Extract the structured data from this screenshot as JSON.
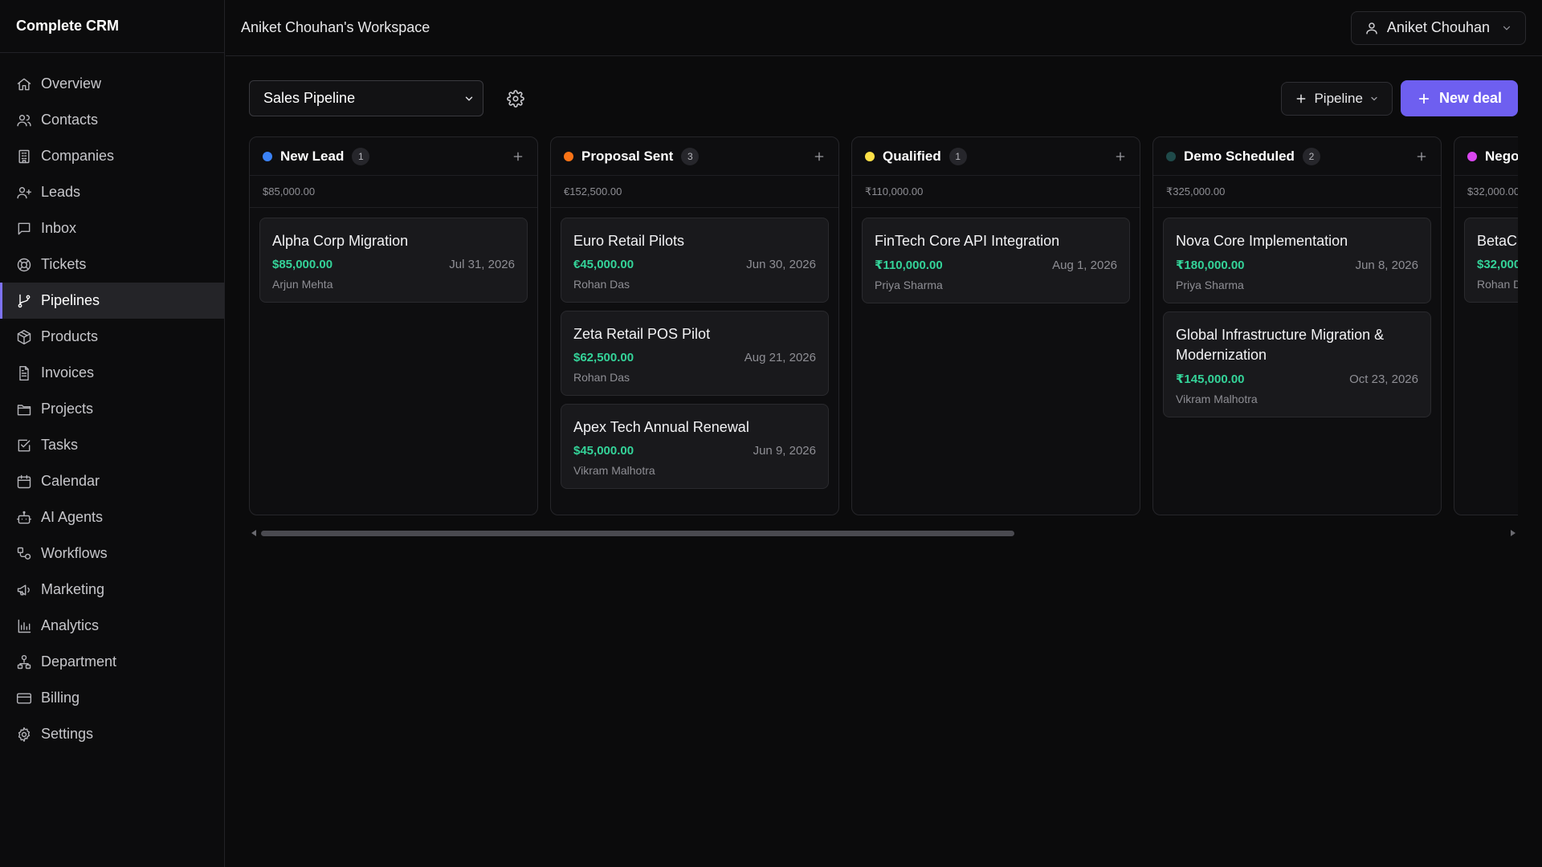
{
  "app": {
    "title": "Complete CRM"
  },
  "sidebar": {
    "items": [
      {
        "label": "Overview",
        "icon": "home-icon"
      },
      {
        "label": "Contacts",
        "icon": "users-icon"
      },
      {
        "label": "Companies",
        "icon": "building-icon"
      },
      {
        "label": "Leads",
        "icon": "user-plus-icon"
      },
      {
        "label": "Inbox",
        "icon": "message-icon"
      },
      {
        "label": "Tickets",
        "icon": "lifebuoy-icon"
      },
      {
        "label": "Pipelines",
        "icon": "git-branch-icon",
        "active": true
      },
      {
        "label": "Products",
        "icon": "package-icon"
      },
      {
        "label": "Invoices",
        "icon": "file-text-icon"
      },
      {
        "label": "Projects",
        "icon": "folder-icon"
      },
      {
        "label": "Tasks",
        "icon": "check-square-icon"
      },
      {
        "label": "Calendar",
        "icon": "calendar-icon"
      },
      {
        "label": "AI Agents",
        "icon": "bot-icon"
      },
      {
        "label": "Workflows",
        "icon": "workflow-icon"
      },
      {
        "label": "Marketing",
        "icon": "megaphone-icon"
      },
      {
        "label": "Analytics",
        "icon": "bar-chart-icon"
      },
      {
        "label": "Department",
        "icon": "network-icon"
      },
      {
        "label": "Billing",
        "icon": "credit-card-icon"
      },
      {
        "label": "Settings",
        "icon": "gear-icon"
      }
    ]
  },
  "header": {
    "workspace": "Aniket Chouhan's Workspace",
    "user_name": "Aniket Chouhan"
  },
  "toolbar": {
    "pipeline_selected": "Sales Pipeline",
    "pipeline_button_label": "Pipeline",
    "new_deal_label": "New deal"
  },
  "colors": {
    "accent": "#6e5ff0",
    "amount": "#34d399"
  },
  "columns": [
    {
      "title": "New Lead",
      "count": "1",
      "total": "$85,000.00",
      "color": "#3b82f6",
      "cards": [
        {
          "title": "Alpha Corp Migration",
          "amount": "$85,000.00",
          "date": "Jul 31, 2026",
          "owner": "Arjun Mehta"
        }
      ]
    },
    {
      "title": "Proposal Sent",
      "count": "3",
      "total": "€152,500.00",
      "color": "#f97316",
      "cards": [
        {
          "title": "Euro Retail Pilots",
          "amount": "€45,000.00",
          "date": "Jun 30, 2026",
          "owner": "Rohan Das"
        },
        {
          "title": "Zeta Retail POS Pilot",
          "amount": "$62,500.00",
          "date": "Aug 21, 2026",
          "owner": "Rohan Das"
        },
        {
          "title": "Apex Tech Annual Renewal",
          "amount": "$45,000.00",
          "date": "Jun 9, 2026",
          "owner": "Vikram Malhotra"
        }
      ]
    },
    {
      "title": "Qualified",
      "count": "1",
      "total": "₹110,000.00",
      "color": "#fde047",
      "cards": [
        {
          "title": "FinTech Core API Integration",
          "amount": "₹110,000.00",
          "date": "Aug 1, 2026",
          "owner": "Priya Sharma"
        }
      ]
    },
    {
      "title": "Demo Scheduled",
      "count": "2",
      "total": "₹325,000.00",
      "color": "#1f4a4a",
      "cards": [
        {
          "title": "Nova Core Implementation",
          "amount": "₹180,000.00",
          "date": "Jun 8, 2026",
          "owner": "Priya Sharma"
        },
        {
          "title": "Global Infrastructure Migration & Modernization",
          "amount": "₹145,000.00",
          "date": "Oct 23, 2026",
          "owner": "Vikram Malhotra"
        }
      ]
    },
    {
      "title": "Nego",
      "count": "",
      "total": "$32,000.00",
      "color": "#d946ef",
      "cards": [
        {
          "title": "BetaC",
          "amount": "$32,000",
          "date": "",
          "owner": "Rohan D"
        }
      ]
    }
  ]
}
